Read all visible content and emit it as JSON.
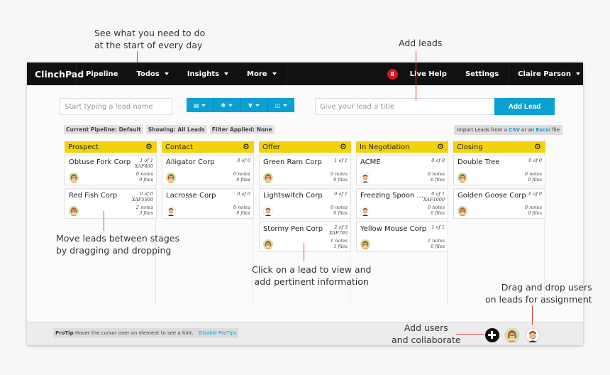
{
  "annotations": {
    "todos": [
      "See what you need to do",
      "at the start of every day"
    ],
    "add_leads": [
      "Add leads"
    ],
    "move_leads": [
      "Move leads between stages",
      "by dragging and dropping"
    ],
    "click_lead": [
      "Click on a lead to view and",
      "add pertinent information"
    ],
    "drag_users": [
      "Drag and drop users",
      "on leads for assignment"
    ],
    "add_users": [
      "Add users",
      "and collaborate"
    ]
  },
  "topbar": {
    "brand": "ClinchPad",
    "nav": [
      "Pipeline",
      "Todos",
      "Insights",
      "More"
    ],
    "badge_count": "8",
    "live_help": "Live Help",
    "settings": "Settings",
    "user": "Claire Parson"
  },
  "search": {
    "placeholder": "Start typing a lead name"
  },
  "toolbar_icons": [
    "calendar-icon",
    "asterisk-icon",
    "filter-icon",
    "columns-icon"
  ],
  "new_lead": {
    "placeholder": "Give your lead a title",
    "button": "Add Lead"
  },
  "filters": [
    "Current Pipeline: Default",
    "Showing: All Leads",
    "Filter Applied: None"
  ],
  "import": {
    "prefix": "Import Leads from a",
    "csv": "CSV",
    "mid": "or an",
    "excel": "Excel",
    "suffix": "file"
  },
  "colors": {
    "accent": "#0aa0d2",
    "stage_header": "#f3d20b",
    "badge": "#d9161c",
    "topbar": "#111111"
  },
  "stages": [
    {
      "name": "Prospect",
      "leads": [
        {
          "title": "Obtuse Fork Corp",
          "progress": "1 of 1",
          "value": "XAF400",
          "notes": "0 notes",
          "files": "0 files",
          "owner": "woman"
        },
        {
          "title": "Red Fish Corp",
          "progress": "0 of 0",
          "value": "XAF5000",
          "notes": "2 notes",
          "files": "3 files",
          "owner": "woman"
        }
      ]
    },
    {
      "name": "Contact",
      "leads": [
        {
          "title": "Alligator Corp",
          "progress": "0 of 0",
          "value": "",
          "notes": "0 notes",
          "files": "0 files",
          "owner": "woman"
        },
        {
          "title": "Lacrosse Corp",
          "progress": "0 of 0",
          "value": "",
          "notes": "0 notes",
          "files": "0 files",
          "owner": "man"
        }
      ]
    },
    {
      "name": "Offer",
      "leads": [
        {
          "title": "Green Ram Corp",
          "progress": "1 of 1",
          "value": "",
          "notes": "0 notes",
          "files": "0 files",
          "owner": "woman"
        },
        {
          "title": "Lightswitch Corp",
          "progress": "0 of 1",
          "value": "",
          "notes": "0 notes",
          "files": "0 files",
          "owner": "man"
        },
        {
          "title": "Stormy Pen Corp",
          "progress": "2 of 3",
          "value": "XAF700",
          "notes": "1 notes",
          "files": "1 files",
          "owner": "woman"
        }
      ]
    },
    {
      "name": "In Negotiation",
      "leads": [
        {
          "title": "ACME",
          "progress": "0 of 0",
          "value": "",
          "notes": "0 notes",
          "files": "0 files",
          "owner": "man"
        },
        {
          "title": "Freezing Spoon ...",
          "progress": "0 of 1",
          "value": "XAF1000",
          "notes": "0 notes",
          "files": "0 files",
          "owner": "man"
        },
        {
          "title": "Yellow Mouse Corp",
          "progress": "1 of 1",
          "value": "",
          "notes": "1 notes",
          "files": "0 files",
          "owner": "woman"
        }
      ]
    },
    {
      "name": "Closing",
      "leads": [
        {
          "title": "Double Tree",
          "progress": "0 of 0",
          "value": "",
          "notes": "0 notes",
          "files": "0 files",
          "owner": "woman"
        },
        {
          "title": "Golden Goose Corp",
          "progress": "0 of 0",
          "value": "",
          "notes": "0 notes",
          "files": "0 files",
          "owner": "woman"
        }
      ]
    }
  ],
  "footer": {
    "protip_label": "ProTip",
    "protip_text": "Hover the cursor over an element to see a hint.",
    "disable": "Disable ProTips"
  }
}
